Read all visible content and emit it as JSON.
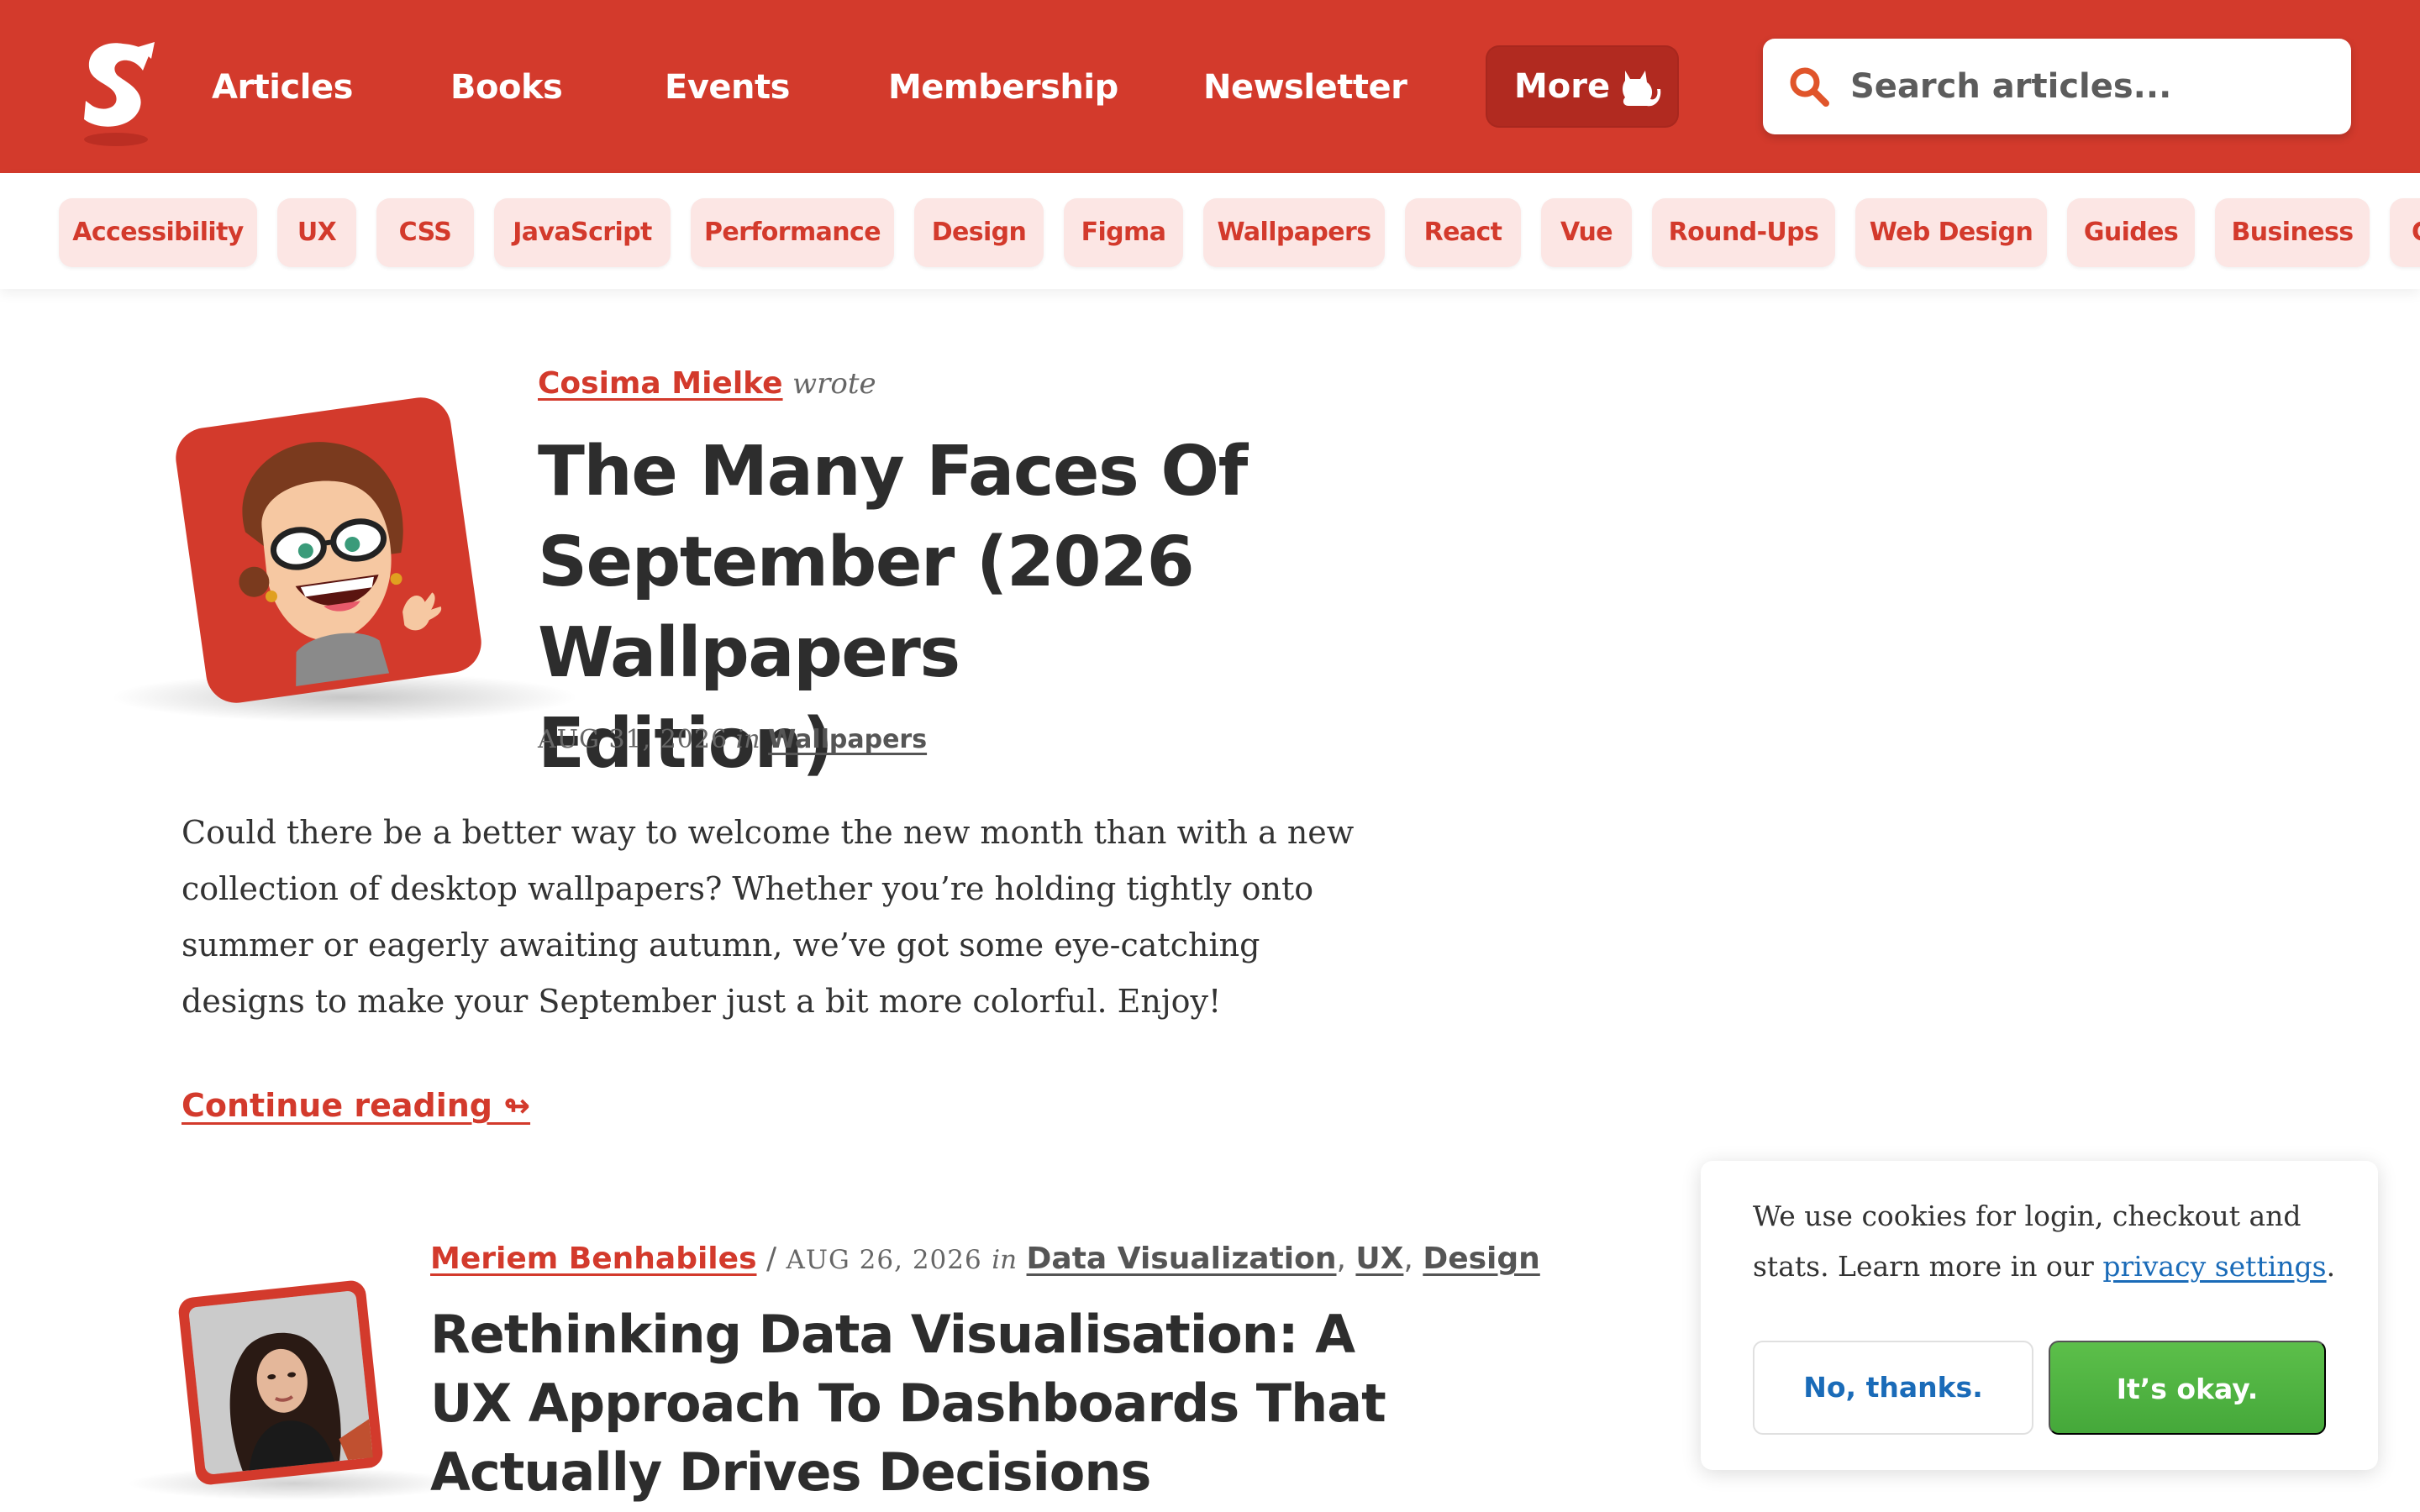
{
  "colors": {
    "brand": "#d33a2c",
    "brand_dark": "#b12a20",
    "tag_bg": "#fce6e4",
    "link_blue": "#1a6bb8",
    "ok_green": "#4fb541"
  },
  "nav": {
    "items": [
      "Articles",
      "Books",
      "Events",
      "Membership",
      "Newsletter"
    ],
    "more_label": "More",
    "more_icon": "cat-icon",
    "search_placeholder": "Search articles..."
  },
  "tags": [
    "Accessibility",
    "UX",
    "CSS",
    "JavaScript",
    "Performance",
    "Design",
    "Figma",
    "Wallpapers",
    "React",
    "Vue",
    "Round-Ups",
    "Web Design",
    "Guides",
    "Business",
    "Career"
  ],
  "articles": [
    {
      "author": "Cosima Mielke",
      "wrote": "wrote",
      "title": "The Many Faces Of September (2026 Wallpapers Edition)",
      "date": "AUG 31, 2026",
      "in": "in",
      "category": "Wallpapers",
      "excerpt": "Could there be a better way to welcome the new month than with a new collection of desktop wallpapers? Whether you’re holding tightly onto summer or eagerly awaiting autumn, we’ve got some eye-catching designs to make your September just a bit more colorful. Enjoy!",
      "continue": "Continue reading ↬"
    },
    {
      "author": "Meriem Benhabiles",
      "separator": "/",
      "date": "AUG 26, 2026",
      "in": "in",
      "categories": [
        "Data Visualization",
        "UX",
        "Design"
      ],
      "title": "Rethinking Data Visualisation: A UX Approach To Dashboards That Actually Drives Decisions"
    }
  ],
  "cookie": {
    "text_before": "We use cookies for login, checkout and stats. Learn more in our ",
    "link": "privacy settings",
    "text_after": ".",
    "no_label": "No, thanks.",
    "ok_label": "It’s okay."
  }
}
